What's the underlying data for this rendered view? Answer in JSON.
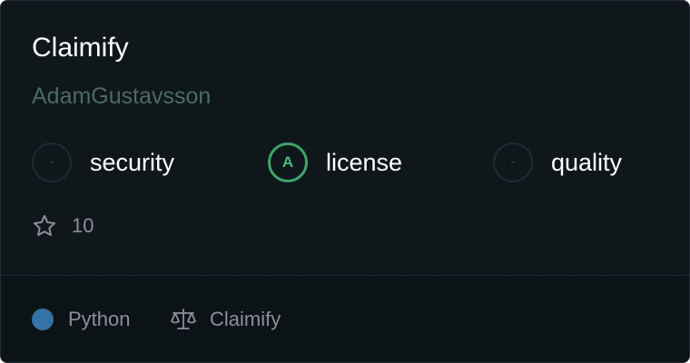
{
  "repo": {
    "name": "Claimify",
    "owner": "AdamGustavsson"
  },
  "scores": [
    {
      "grade": "-",
      "label": "security",
      "status": "none"
    },
    {
      "grade": "A",
      "label": "license",
      "status": "ok"
    },
    {
      "grade": "-",
      "label": "quality",
      "status": "none"
    }
  ],
  "stars": {
    "icon": "star-icon",
    "count": "10"
  },
  "footer": {
    "language": {
      "name": "Python",
      "color": "#3572a5"
    },
    "license": {
      "icon": "scale-icon",
      "name": "Claimify"
    }
  },
  "colors": {
    "background": "#0f171b",
    "accent_green": "#3fa46a",
    "owner_text": "#4d6b60"
  }
}
